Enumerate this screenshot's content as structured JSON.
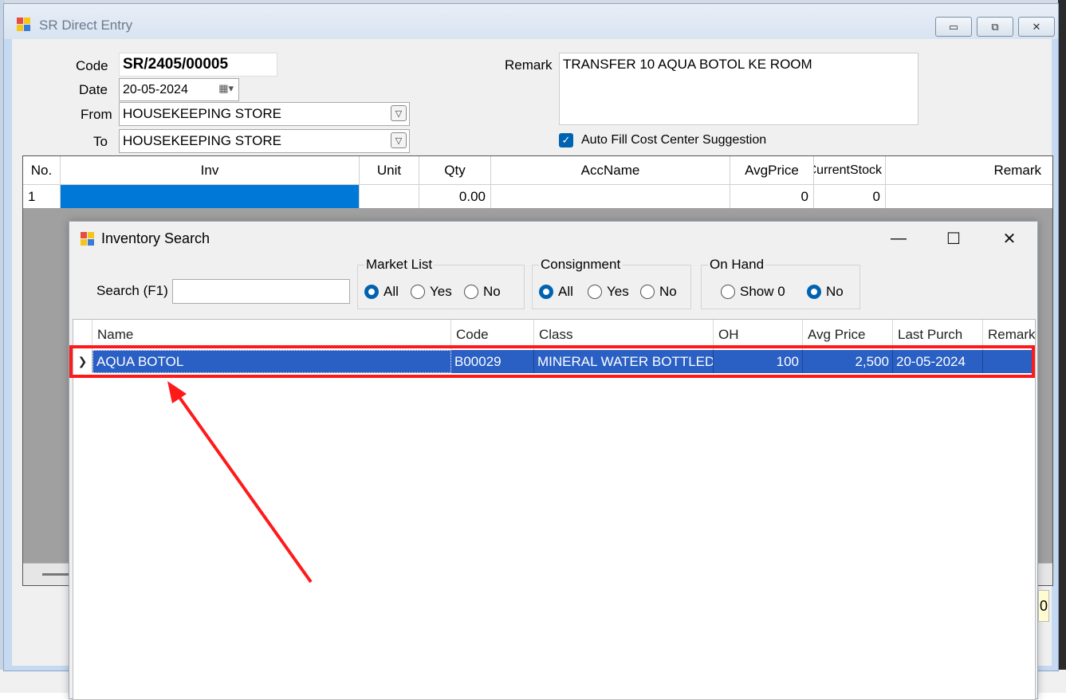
{
  "sr_window": {
    "title": "SR Direct Entry",
    "controls": {
      "minimize": "▭",
      "restore": "⧉",
      "close": "✕"
    }
  },
  "form": {
    "code_label": "Code",
    "code_value": "SR/2405/00005",
    "date_label": "Date",
    "date_value": "20-05-2024",
    "from_label": "From",
    "from_value": "HOUSEKEEPING STORE",
    "to_label": "To",
    "to_value": "HOUSEKEEPING STORE",
    "remark_label": "Remark",
    "remark_value": "TRANSFER 10 AQUA BOTOL KE ROOM",
    "auto_fill_label": "Auto Fill Cost Center Suggestion",
    "auto_fill_checked": true
  },
  "grid": {
    "columns": [
      "No.",
      "Inv",
      "Unit",
      "Qty",
      "AccName",
      "AvgPrice",
      "CurrentStock",
      "Remark"
    ],
    "rows": [
      {
        "no": "1",
        "inv": "",
        "unit": "",
        "qty": "0.00",
        "accname": "",
        "avgprice": "0",
        "currentstock": "0",
        "remark": ""
      }
    ]
  },
  "inventory_search": {
    "title": "Inventory Search",
    "search_label": "Search (F1)",
    "search_value": "",
    "market_list": {
      "title": "Market List",
      "options": [
        "All",
        "Yes",
        "No"
      ],
      "selected": "All"
    },
    "consignment": {
      "title": "Consignment",
      "options": [
        "All",
        "Yes",
        "No"
      ],
      "selected": "All"
    },
    "on_hand": {
      "title": "On Hand",
      "options": [
        "Show 0",
        "No"
      ],
      "selected": "No"
    },
    "columns": [
      "Name",
      "Code",
      "Class",
      "OH",
      "Avg Price",
      "Last Purch",
      "Remark"
    ],
    "rows": [
      {
        "name": "AQUA BOTOL",
        "code": "B00029",
        "class": "MINERAL WATER BOTTLED…",
        "oh": "100",
        "avg_price": "2,500",
        "last_purch": "20-05-2024",
        "remark": ""
      }
    ]
  },
  "colors": {
    "selection": "#2a5fc4",
    "grid_selection": "#0078d7",
    "annotation": "#ff1a1a"
  }
}
